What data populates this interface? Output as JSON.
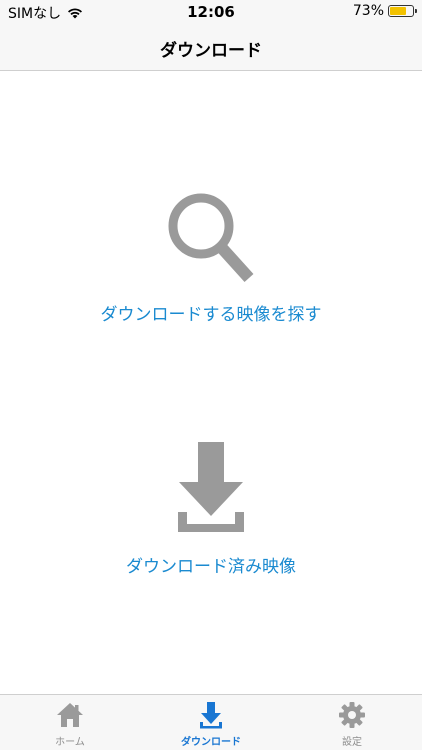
{
  "status": {
    "carrier": "SIMなし",
    "time": "12:06",
    "battery_percent": "73%",
    "battery_level": 0.73
  },
  "nav": {
    "title": "ダウンロード"
  },
  "content": {
    "search_label": "ダウンロードする映像を探す",
    "downloaded_label": "ダウンロード済み映像"
  },
  "tabs": [
    {
      "label": "ホーム",
      "icon": "home-icon"
    },
    {
      "label": "ダウンロード",
      "icon": "download-icon"
    },
    {
      "label": "設定",
      "icon": "gear-icon"
    }
  ],
  "colors": {
    "accent": "#1a8ad0",
    "tab_active": "#1976d2",
    "icon_gray": "#9a9a9a",
    "battery": "#f2c200"
  }
}
